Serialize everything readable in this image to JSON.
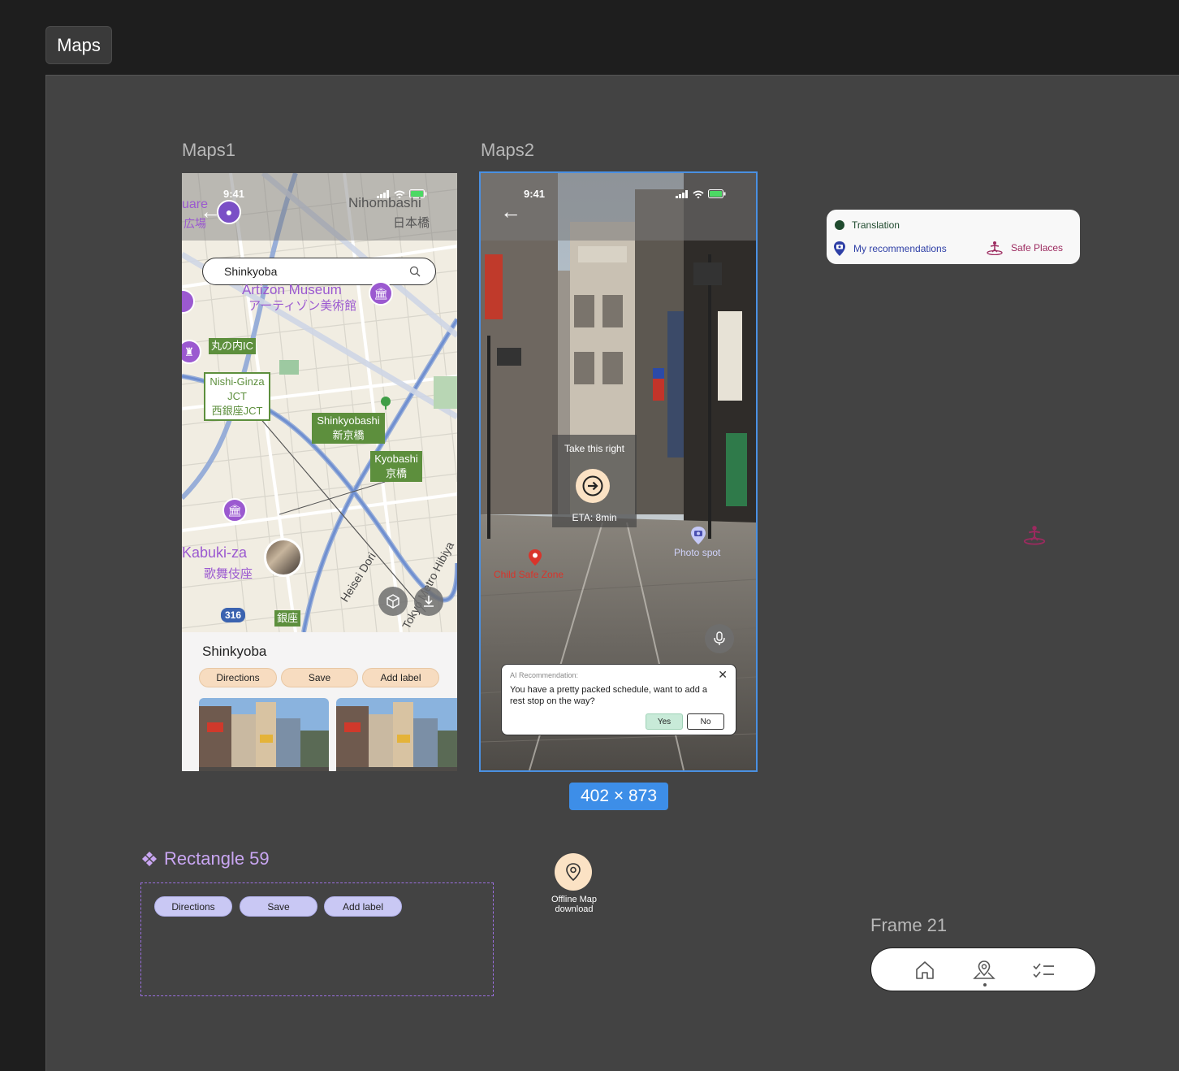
{
  "page": {
    "title": "Maps"
  },
  "frames": {
    "maps1": {
      "label": "Maps1",
      "status_time": "9:41",
      "search_value": "Shinkyoba",
      "map_labels": {
        "nihombashi_en": "Nihombashi",
        "nihombashi_jp": "日本橋",
        "square_en": "uare",
        "square_jp": "広場",
        "museum_en": "Artizon Museum",
        "museum_jp": "アーティゾン美術館",
        "marunouchi_ic": "丸の内IC",
        "nishi_ginza": "Nishi-Ginza",
        "jct": "JCT",
        "nishi_ginza_jp": "西銀座JCT",
        "shinkyobashi_en": "Shinkyobashi",
        "shinkyobashi_jp": "新京橋",
        "kyobashi_en": "Kyobashi",
        "kyobashi_jp": "京橋",
        "kabukiza_en": "Kabuki-za",
        "kabukiza_jp": "歌舞伎座",
        "route": "316",
        "ginza_jp": "銀座",
        "heisei_dori": "Heisei Dori",
        "tokyo_metro": "Tokyo Metro Hibiya"
      },
      "place_sheet": {
        "title": "Shinkyoba",
        "buttons": [
          "Directions",
          "Save",
          "Add label"
        ]
      }
    },
    "maps2": {
      "label": "Maps2",
      "status_time": "9:41",
      "nav_instruction": "Take this right",
      "eta": "ETA: 8min",
      "markers": {
        "photo_spot": "Photo spot",
        "child_safe_zone": "Child Safe Zone"
      },
      "ai_card": {
        "heading": "AI Recommendation:",
        "body": "You have a pretty packed schedule, want to add a rest stop on the way?",
        "yes": "Yes",
        "no": "No"
      },
      "dimensions": "402 × 873"
    }
  },
  "legend": {
    "translation": "Translation",
    "recommendations": "My recommendations",
    "safe_places": "Safe Places"
  },
  "component": {
    "label": "Rectangle 59",
    "buttons": [
      "Directions",
      "Save",
      "Add label"
    ]
  },
  "offline_map": {
    "label_line1": "Offline Map",
    "label_line2": "download"
  },
  "frame21": {
    "label": "Frame 21"
  },
  "colors": {
    "canvas": "#434343",
    "selection": "#4a90e2",
    "chip_peach": "#f7dcc0",
    "chip_lavender": "#c9c8f4",
    "map_green": "#5d8f3d",
    "museum_purple": "#9b59d0",
    "legend_translation": "#1f4a2e",
    "legend_recommend": "#2e3fa6",
    "legend_safe": "#9c2a5f"
  }
}
